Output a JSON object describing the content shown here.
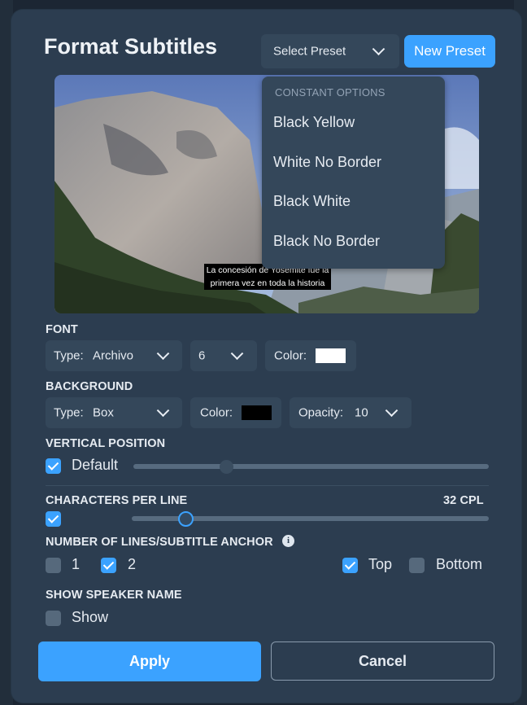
{
  "dialog": {
    "title": "Format Subtitles",
    "select_preset_label": "Select Preset",
    "new_preset_label": "New Preset"
  },
  "preset_dropdown": {
    "header": "CONSTANT OPTIONS",
    "items": [
      "Black Yellow",
      "White No Border",
      "Black White",
      "Black No Border"
    ]
  },
  "preview": {
    "caption_line1": "La concesión de Yosemite fue la",
    "caption_line2": "primera vez en toda la historia"
  },
  "font": {
    "heading": "FONT",
    "type_label": "Type:",
    "type_value": "Archivo",
    "size_value": "6",
    "color_label": "Color:",
    "color_value": "#ffffff"
  },
  "background": {
    "heading": "BACKGROUND",
    "type_label": "Type:",
    "type_value": "Box",
    "color_label": "Color:",
    "color_value": "#000000",
    "opacity_label": "Opacity:",
    "opacity_value": "10"
  },
  "vertical_position": {
    "heading": "VERTICAL POSITION",
    "default_label": "Default",
    "default_checked": true
  },
  "chars_per_line": {
    "heading": "CHARACTERS PER LINE",
    "value_text": "32 CPL",
    "checked": true
  },
  "lines_anchor": {
    "heading": "NUMBER OF LINES/SUBTITLE ANCHOR",
    "info_icon": "info-icon",
    "option_1": "1",
    "option_2": "2",
    "option_1_checked": false,
    "option_2_checked": true,
    "top_label": "Top",
    "bottom_label": "Bottom",
    "top_checked": true,
    "bottom_checked": false
  },
  "speaker_name": {
    "heading": "SHOW SPEAKER NAME",
    "show_label": "Show",
    "checked": false
  },
  "actions": {
    "apply_label": "Apply",
    "cancel_label": "Cancel"
  },
  "colors": {
    "accent": "#3ba2ff",
    "panel": "#2c3d50",
    "control": "#34475a"
  }
}
